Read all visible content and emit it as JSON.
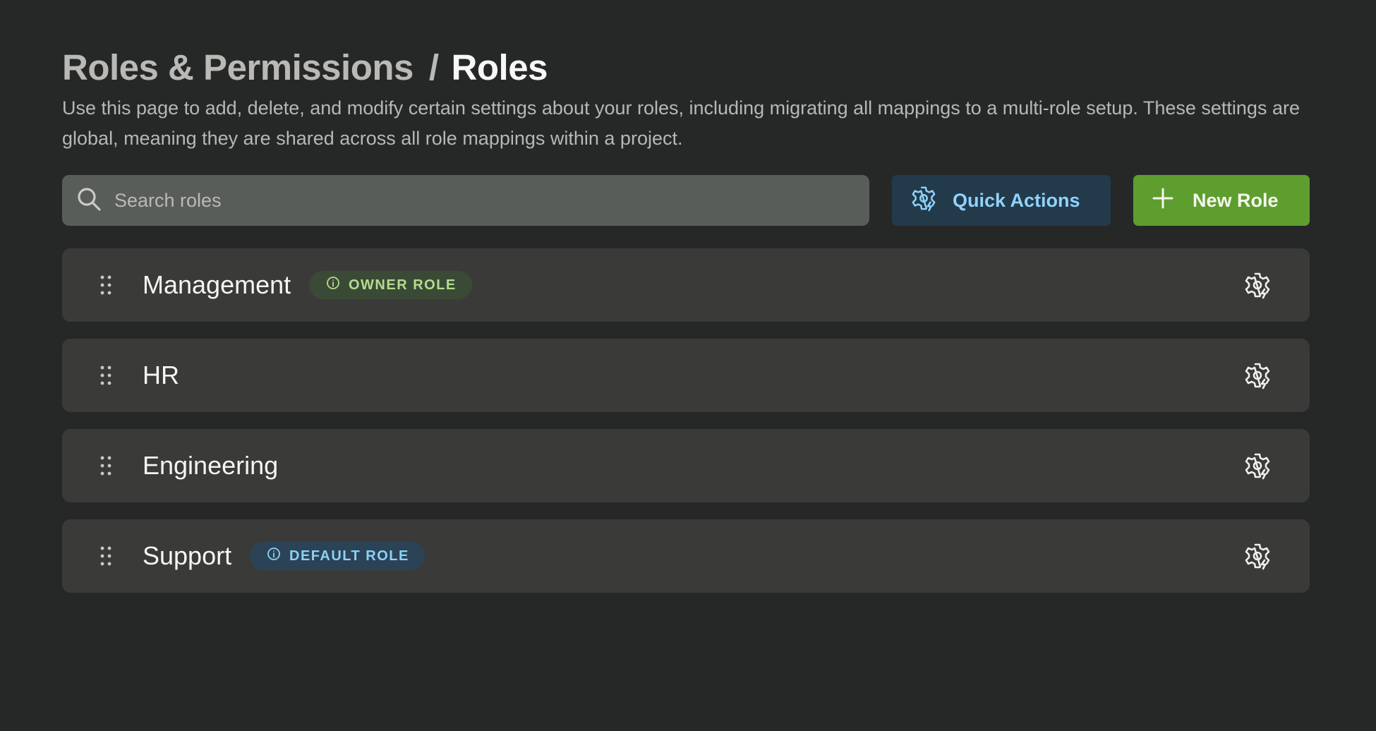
{
  "breadcrumb": {
    "parent": "Roles & Permissions",
    "separator": "/",
    "current": "Roles"
  },
  "description": "Use this page to add, delete, and modify certain settings about your roles, including migrating all mappings to a multi-role setup. These settings are global, meaning they are shared across all role mappings within a project.",
  "search": {
    "placeholder": "Search roles",
    "value": "",
    "icon": "search-icon"
  },
  "toolbar": {
    "quick_actions_label": "Quick Actions",
    "quick_actions_icon": "gear-bolt-icon",
    "new_role_label": "New Role",
    "new_role_icon": "plus-icon"
  },
  "roles": [
    {
      "name": "Management",
      "badge": "OWNER ROLE",
      "badge_type": "owner"
    },
    {
      "name": "HR",
      "badge": "",
      "badge_type": ""
    },
    {
      "name": "Engineering",
      "badge": "",
      "badge_type": ""
    },
    {
      "name": "Support",
      "badge": "DEFAULT ROLE",
      "badge_type": "default"
    }
  ],
  "colors": {
    "background": "#262827",
    "row_background": "#3a3b39",
    "search_background": "#595d5a",
    "quick_actions_background": "#233a4b",
    "quick_actions_text": "#8fd3fb",
    "new_role_background": "#5e9e2f",
    "owner_badge_background": "#3b4a36",
    "owner_badge_text": "#b4dc8f",
    "default_badge_background": "#2b4356",
    "default_badge_text": "#8cd1f6"
  }
}
